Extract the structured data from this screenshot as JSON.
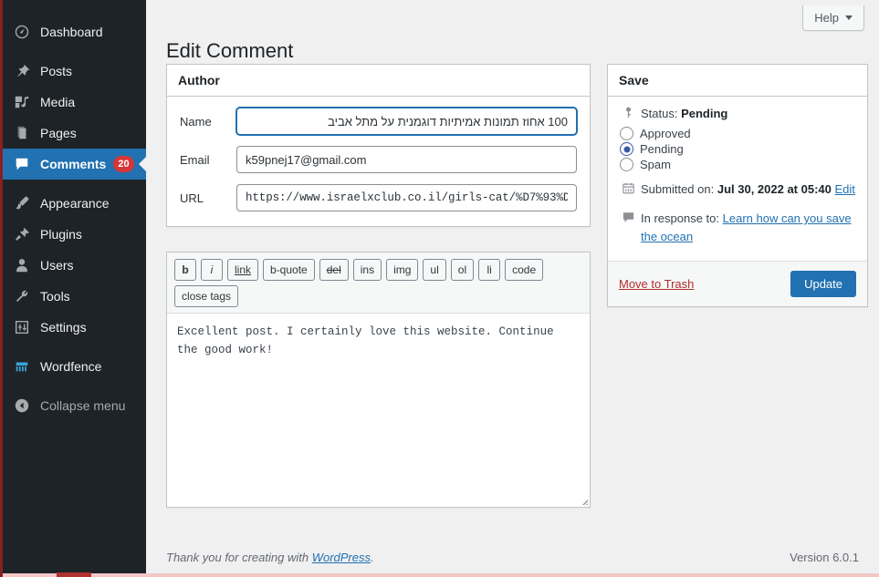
{
  "sidebar": {
    "items": [
      {
        "label": "Dashboard",
        "icon": "dashboard-icon",
        "active": false,
        "badge": null
      },
      {
        "label": "Posts",
        "icon": "pin-icon",
        "active": false,
        "badge": null
      },
      {
        "label": "Media",
        "icon": "media-icon",
        "active": false,
        "badge": null
      },
      {
        "label": "Pages",
        "icon": "pages-icon",
        "active": false,
        "badge": null
      },
      {
        "label": "Comments",
        "icon": "comment-icon",
        "active": true,
        "badge": "20"
      },
      {
        "label": "Appearance",
        "icon": "brush-icon",
        "active": false,
        "badge": null
      },
      {
        "label": "Plugins",
        "icon": "plug-icon",
        "active": false,
        "badge": null
      },
      {
        "label": "Users",
        "icon": "user-icon",
        "active": false,
        "badge": null
      },
      {
        "label": "Tools",
        "icon": "wrench-icon",
        "active": false,
        "badge": null
      },
      {
        "label": "Settings",
        "icon": "sliders-icon",
        "active": false,
        "badge": null
      },
      {
        "label": "Wordfence",
        "icon": "wordfence-icon",
        "active": false,
        "badge": null
      },
      {
        "label": "Collapse menu",
        "icon": "collapse-arrow-icon",
        "active": false,
        "badge": null
      }
    ]
  },
  "header": {
    "help_label": "Help",
    "page_title": "Edit Comment"
  },
  "author": {
    "title": "Author",
    "name_label": "Name",
    "name_value": "100 אחוז תמונות אמיתיות דוגמנית על מתל אביב",
    "email_label": "Email",
    "email_value": "k59pnej17@gmail.com",
    "url_label": "URL",
    "url_value": "https://www.israelxclub.co.il/girls-cat/%D7%93%D"
  },
  "editor": {
    "quicktags": [
      {
        "label": "b",
        "style": "b"
      },
      {
        "label": "i",
        "style": "i"
      },
      {
        "label": "link",
        "style": "u"
      },
      {
        "label": "b-quote",
        "style": ""
      },
      {
        "label": "del",
        "style": "s"
      },
      {
        "label": "ins",
        "style": ""
      },
      {
        "label": "img",
        "style": ""
      },
      {
        "label": "ul",
        "style": ""
      },
      {
        "label": "ol",
        "style": ""
      },
      {
        "label": "li",
        "style": ""
      },
      {
        "label": "code",
        "style": ""
      },
      {
        "label": "close tags",
        "style": ""
      }
    ],
    "comment_text": "Excellent post. I certainly love this website. Continue the good work!"
  },
  "save": {
    "title": "Save",
    "status_prefix": "Status:",
    "status_value": "Pending",
    "radios": [
      {
        "label": "Approved",
        "checked": false
      },
      {
        "label": "Pending",
        "checked": true
      },
      {
        "label": "Spam",
        "checked": false
      }
    ],
    "submitted_prefix": "Submitted on:",
    "submitted_value": "Jul 30, 2022 at 05:40",
    "submitted_edit_label": "Edit",
    "response_prefix": "In response to:",
    "response_link": "Learn how can you save the ocean",
    "trash_label": "Move to Trash",
    "update_label": "Update"
  },
  "footer": {
    "thanks_prefix": "Thank you for creating with",
    "wordpress_link": "WordPress",
    "thanks_suffix": ".",
    "version": "Version 6.0.1"
  },
  "colors": {
    "sidebar_bg": "#1d2327",
    "accent_blue": "#2271b1",
    "badge_red": "#d63638",
    "trash_red": "#b32d2e",
    "page_bg": "#f0f0f1"
  }
}
